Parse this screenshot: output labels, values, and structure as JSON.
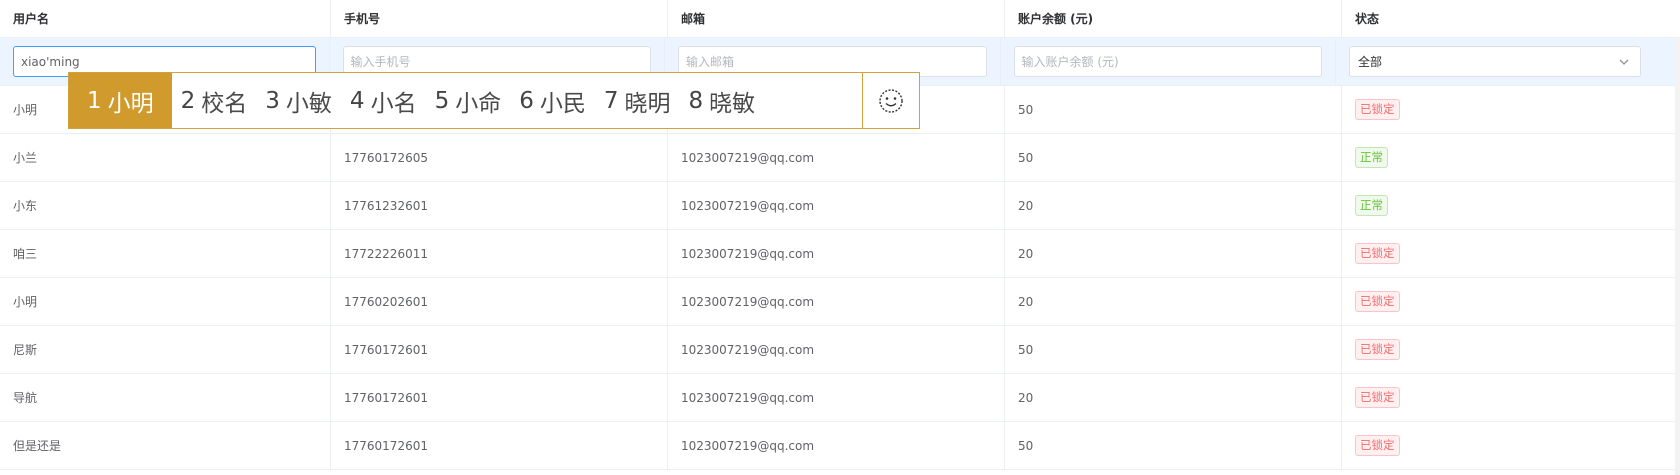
{
  "columns": {
    "username": "用户名",
    "phone": "手机号",
    "email": "邮箱",
    "balance": "账户余额 (元)",
    "status": "状态"
  },
  "filters": {
    "username_value": "xiao'ming",
    "phone_placeholder": "输入手机号",
    "email_placeholder": "输入邮箱",
    "balance_placeholder": "输入账户余额 (元)",
    "status_selected": "全部"
  },
  "rows": [
    {
      "username": "小明",
      "phone": "",
      "email": "",
      "balance": "50",
      "status": "已锁定",
      "status_kind": "locked"
    },
    {
      "username": "小兰",
      "phone": "17760172605",
      "email": "1023007219@qq.com",
      "balance": "50",
      "status": "正常",
      "status_kind": "normal"
    },
    {
      "username": "小东",
      "phone": "17761232601",
      "email": "1023007219@qq.com",
      "balance": "20",
      "status": "正常",
      "status_kind": "normal"
    },
    {
      "username": "咱三",
      "phone": "17722226011",
      "email": "1023007219@qq.com",
      "balance": "20",
      "status": "已锁定",
      "status_kind": "locked"
    },
    {
      "username": "小明",
      "phone": "17760202601",
      "email": "1023007219@qq.com",
      "balance": "20",
      "status": "已锁定",
      "status_kind": "locked"
    },
    {
      "username": "尼斯",
      "phone": "17760172601",
      "email": "1023007219@qq.com",
      "balance": "50",
      "status": "已锁定",
      "status_kind": "locked"
    },
    {
      "username": "导航",
      "phone": "17760172601",
      "email": "1023007219@qq.com",
      "balance": "20",
      "status": "已锁定",
      "status_kind": "locked"
    },
    {
      "username": "但是还是",
      "phone": "17760172601",
      "email": "1023007219@qq.com",
      "balance": "50",
      "status": "已锁定",
      "status_kind": "locked"
    }
  ],
  "ime": {
    "candidates": [
      {
        "num": "1",
        "text": "小明"
      },
      {
        "num": "2",
        "text": "校名"
      },
      {
        "num": "3",
        "text": "小敏"
      },
      {
        "num": "4",
        "text": "小名"
      },
      {
        "num": "5",
        "text": "小命"
      },
      {
        "num": "6",
        "text": "小民"
      },
      {
        "num": "7",
        "text": "晓明"
      },
      {
        "num": "8",
        "text": "晓敏"
      }
    ],
    "emoji_icon": "smiley-icon"
  },
  "colors": {
    "header_filter_bg": "#ecf5ff",
    "ime_accent": "#d09a2d",
    "locked": "#f56c6c",
    "normal": "#67c23a",
    "active_border": "#409eff"
  }
}
